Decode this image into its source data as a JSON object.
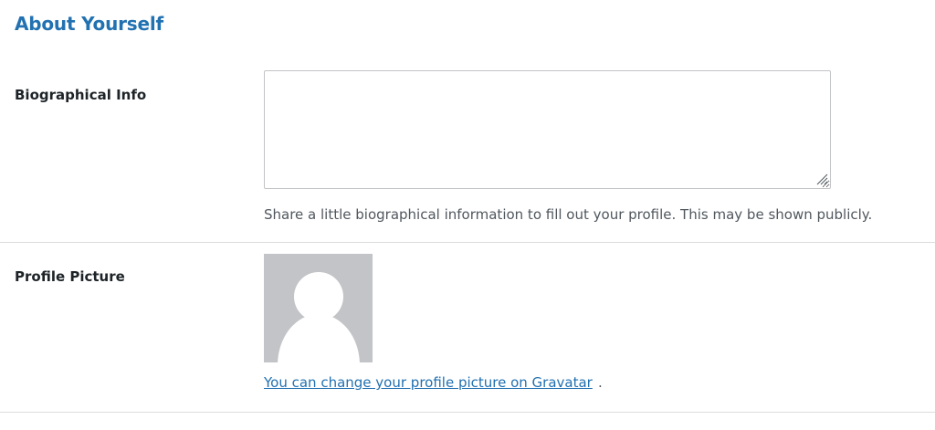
{
  "section": {
    "title": "About Yourself"
  },
  "bio": {
    "label": "Biographical Info",
    "value": "",
    "description": "Share a little biographical information to fill out your profile. This may be shown publicly."
  },
  "profile_picture": {
    "label": "Profile Picture",
    "avatar_icon": "default-avatar-silhouette",
    "link_text": "You can change your profile picture on Gravatar",
    "link_suffix": "."
  },
  "colors": {
    "accent": "#2271b1",
    "avatar_bg": "#c3c4c7",
    "divider": "#dcdcde",
    "description_text": "#50575e"
  }
}
